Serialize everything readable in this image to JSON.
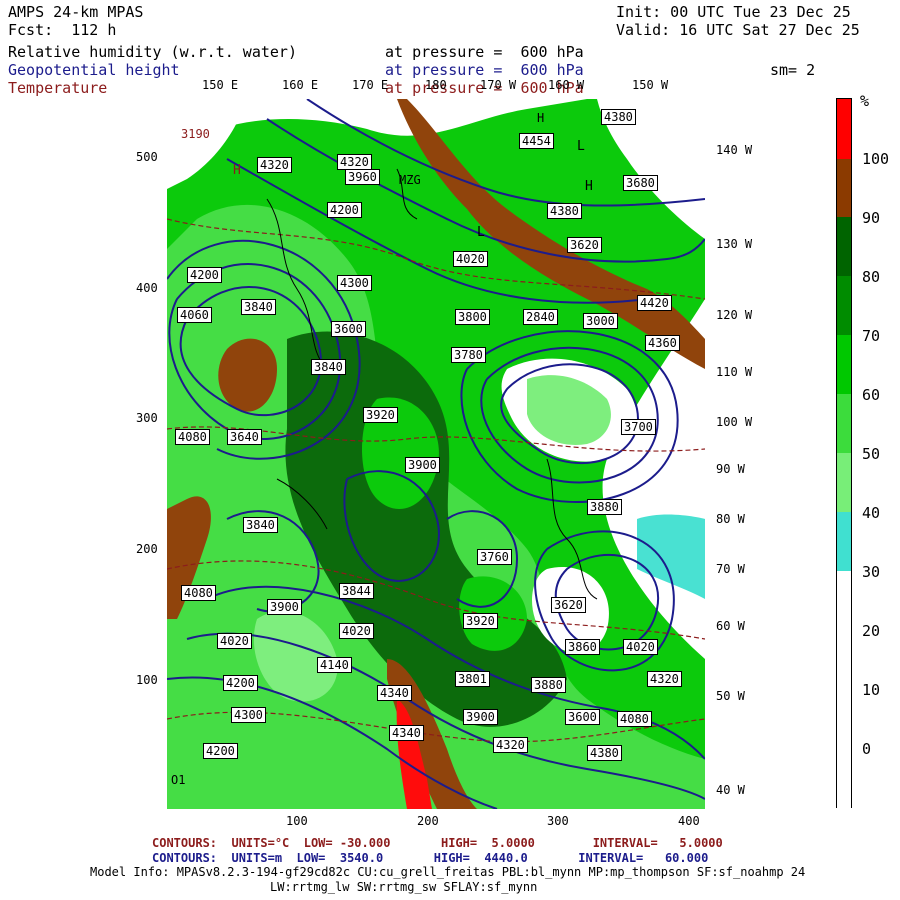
{
  "header": {
    "model": "AMPS 24-km MPAS",
    "fcst": "Fcst:  112 h",
    "init": "Init: 00 UTC Tue 23 Dec 25",
    "valid": "Valid: 16 UTC Sat 27 Dec 25",
    "smoothing": "sm= 2",
    "fields": [
      {
        "name": "Relative humidity (w.r.t. water)",
        "level": "at pressure =  600 hPa",
        "color": "#000000"
      },
      {
        "name": "Geopotential height",
        "level": "at pressure =  600 hPa",
        "color": "#1c1c8c"
      },
      {
        "name": "Temperature",
        "level": "at pressure =  600 hPa",
        "color": "#8c1c1c"
      }
    ]
  },
  "axes": {
    "x_ticks": [
      "100",
      "200",
      "300",
      "400"
    ],
    "y_ticks": [
      "100",
      "200",
      "300",
      "400",
      "500"
    ],
    "lon_top": [
      "150 E",
      "160 E",
      "170 E",
      "180",
      "170 W",
      "160 W",
      "150 W"
    ],
    "lon_right": [
      "140 W",
      "130 W",
      "120 W",
      "110 W",
      "100 W",
      "90 W",
      "80 W",
      "70 W",
      "60 W",
      "50 W",
      "40 W"
    ]
  },
  "colorbar": {
    "unit": "%",
    "labels": [
      "100",
      "90",
      "80",
      "70",
      "60",
      "50",
      "40",
      "30",
      "20",
      "10",
      "0"
    ],
    "colors": {
      "above_100": "#ff0000",
      "90_100": "#8b3a00",
      "80_90": "#006400",
      "70_80": "#008c00",
      "60_70": "#00c800",
      "50_60": "#3cdc3c",
      "40_50": "#78ee78",
      "30_40": "#40e0d0",
      "below_30": "#ffffff"
    }
  },
  "map": {
    "height_labels": [
      "3190",
      "4320",
      "4320",
      "3960",
      "4200",
      "H",
      "4454",
      "4380",
      "4380",
      "3620",
      "4020",
      "3680",
      "4060",
      "3840",
      "4200",
      "4300",
      "3600",
      "4420",
      "3800",
      "3840",
      "2840",
      "3000",
      "4360",
      "3780",
      "4080",
      "3640",
      "3900",
      "3920",
      "3700",
      "3880",
      "3840",
      "3760",
      "3900",
      "3844",
      "4080",
      "4020",
      "3620",
      "3920",
      "4020",
      "3860",
      "4140",
      "4200",
      "4300",
      "4020",
      "3801",
      "3880",
      "4320",
      "4340",
      "3900",
      "4340",
      "4320",
      "4200",
      "3600",
      "4080",
      "4380"
    ],
    "region_labels": [
      "H",
      "H",
      "L",
      "MZG",
      "L",
      "O1"
    ]
  },
  "legend_lines": [
    {
      "text": "CONTOURS:  UNITS=°C  LOW= -30.000       HIGH=  5.0000        INTERVAL=   5.0000",
      "color": "#8c1c1c"
    },
    {
      "text": "CONTOURS:  UNITS=m  LOW=  3540.0       HIGH=  4440.0       INTERVAL=   60.000",
      "color": "#1c1c8c"
    }
  ],
  "model_info": [
    "Model Info: MPASv8.2.3-194-gf29cd82c CU:cu_grell_freitas PBL:bl_mynn MP:mp_thompson SF:sf_noahmp 24",
    "LW:rrtmg_lw SW:rrtmg_sw SFLAY:sf_mynn"
  ]
}
